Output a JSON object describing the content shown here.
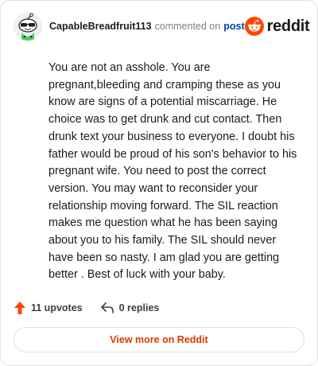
{
  "header": {
    "username": "CapableBreadfruit113",
    "commented_text": "commented on",
    "post_link": "post",
    "brand_word": "reddit",
    "avatar_icon": "snoo-avatar-icon",
    "brand_icon": "reddit-snoo-logo-icon"
  },
  "comment": {
    "body": "You are not an asshole. You are pregnant,bleeding and cramping these as you know are signs of a potential miscarriage. He choice was to get drunk and cut contact. Then drunk text your business to everyone. I doubt his father would be proud of his son's behavior to his pregnant wife. You need to post the correct version. You may want to reconsider your relationship moving forward. The SIL reaction makes me question what he has been saying about you to his family. The SIL should never have been so nasty. I am glad you are getting better . Best of luck with your baby."
  },
  "actions": {
    "upvotes_label": "11 upvotes",
    "replies_label": "0 replies",
    "upvote_icon": "upvote-arrow-icon",
    "reply_icon": "reply-arrow-icon"
  },
  "footer": {
    "view_more_label": "View more on Reddit"
  },
  "colors": {
    "accent": "#d93a00",
    "link": "#0045ac",
    "upvote": "#ff4500",
    "text": "#1c1c1c",
    "muted": "#7c8287"
  }
}
